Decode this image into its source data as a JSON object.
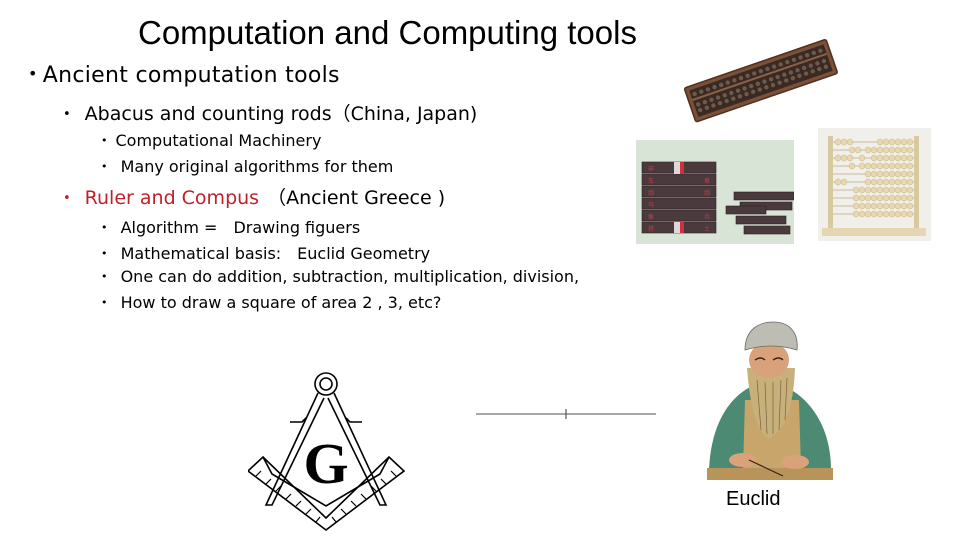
{
  "slide": {
    "title": "Computation and Computing tools",
    "bullet_glyph": "•",
    "level1": {
      "text": "Ancient computation tools"
    },
    "abacus_item": {
      "text": "Abacus and  counting rods（China, Japan)"
    },
    "abacus_subitems": [
      {
        "text": "Computational Machinery"
      },
      {
        "text": " Many original algorithms for them"
      }
    ],
    "ruler_item": {
      "highlight": "Ruler and Compus",
      "rest": "（Ancient Greece )"
    },
    "ruler_subitems": [
      {
        "text": " Algorithm =　Drawing figuers"
      },
      {
        "text": " Mathematical basis:　Euclid Geometry"
      },
      {
        "text": " One  can do  addition, subtraction, multiplication, division,"
      },
      {
        "text": "  How to draw a square of area 2 , 3, etc?"
      }
    ],
    "images": {
      "soroban": "japanese-abacus-photo",
      "counting_rods": "counting-rods-photo",
      "bead_frame": "wooden-bead-abacus-photo",
      "compass_square": "square-and-compasses-symbol",
      "compass_letter": "G",
      "line_segment": "line-segment-with-midpoint",
      "euclid": "euclid-portrait"
    },
    "euclid_caption": "Euclid",
    "colors": {
      "accent_red": "#c0202a",
      "text": "#000000"
    }
  }
}
